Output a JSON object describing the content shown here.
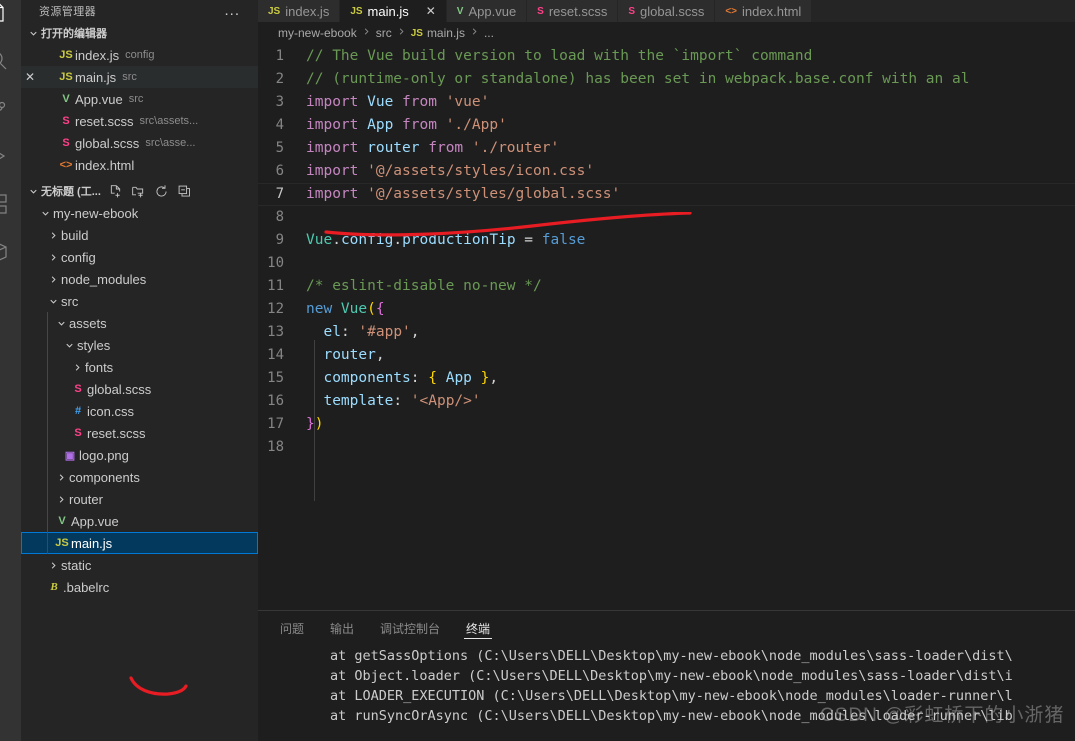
{
  "activitybar": {
    "items": [
      {
        "name": "explorer-icon",
        "active": true
      },
      {
        "name": "search-icon",
        "active": false
      },
      {
        "name": "source-control-icon",
        "active": false
      },
      {
        "name": "run-and-debug-icon",
        "active": false
      },
      {
        "name": "extensions-icon",
        "active": false
      },
      {
        "name": "remote-explorer-icon",
        "active": false
      }
    ]
  },
  "sidebar": {
    "title": "资源管理器",
    "more_label": "...",
    "open_editors": {
      "label": "打开的编辑器",
      "items": [
        {
          "name": "index.js",
          "desc": "config",
          "icon": "js",
          "active": false,
          "dirty": false
        },
        {
          "name": "main.js",
          "desc": "src",
          "icon": "js",
          "active": true,
          "dirty": false
        },
        {
          "name": "App.vue",
          "desc": "src",
          "icon": "vue",
          "active": false,
          "dirty": false
        },
        {
          "name": "reset.scss",
          "desc": "src\\assets...",
          "icon": "scss",
          "active": false,
          "dirty": false
        },
        {
          "name": "global.scss",
          "desc": "src\\asse...",
          "icon": "scss",
          "active": false,
          "dirty": false
        },
        {
          "name": "index.html",
          "desc": "",
          "icon": "html",
          "active": false,
          "dirty": false
        }
      ],
      "close_glyph": "✕"
    },
    "workspace": {
      "label": "无标题 (工...",
      "actions": [
        "new-file-icon",
        "new-folder-icon",
        "refresh-icon",
        "collapse-all-icon"
      ],
      "tree": [
        {
          "label": "my-new-ebook",
          "depth": 1,
          "type": "folder",
          "expanded": true
        },
        {
          "label": "build",
          "depth": 2,
          "type": "folder",
          "expanded": false
        },
        {
          "label": "config",
          "depth": 2,
          "type": "folder",
          "expanded": false
        },
        {
          "label": "node_modules",
          "depth": 2,
          "type": "folder",
          "expanded": false
        },
        {
          "label": "src",
          "depth": 2,
          "type": "folder",
          "expanded": true
        },
        {
          "label": "assets",
          "depth": 3,
          "type": "folder",
          "expanded": true
        },
        {
          "label": "styles",
          "depth": 4,
          "type": "folder",
          "expanded": true
        },
        {
          "label": "fonts",
          "depth": 5,
          "type": "folder",
          "expanded": false
        },
        {
          "label": "global.scss",
          "depth": 5,
          "type": "file",
          "icon": "scss"
        },
        {
          "label": "icon.css",
          "depth": 5,
          "type": "file",
          "icon": "css"
        },
        {
          "label": "reset.scss",
          "depth": 5,
          "type": "file",
          "icon": "scss"
        },
        {
          "label": "logo.png",
          "depth": 4,
          "type": "file",
          "icon": "png"
        },
        {
          "label": "components",
          "depth": 3,
          "type": "folder",
          "expanded": false
        },
        {
          "label": "router",
          "depth": 3,
          "type": "folder",
          "expanded": false
        },
        {
          "label": "App.vue",
          "depth": 3,
          "type": "file",
          "icon": "vue"
        },
        {
          "label": "main.js",
          "depth": 3,
          "type": "file",
          "icon": "js",
          "selected": true
        },
        {
          "label": "static",
          "depth": 2,
          "type": "folder",
          "expanded": false
        },
        {
          "label": ".babelrc",
          "depth": 2,
          "type": "file",
          "icon": "babel"
        }
      ]
    }
  },
  "tabs": [
    {
      "label": "index.js",
      "icon": "js",
      "active": false
    },
    {
      "label": "main.js",
      "icon": "js",
      "active": true,
      "close": "✕"
    },
    {
      "label": "App.vue",
      "icon": "vue",
      "active": false
    },
    {
      "label": "reset.scss",
      "icon": "scss",
      "active": false
    },
    {
      "label": "global.scss",
      "icon": "scss",
      "active": false
    },
    {
      "label": "index.html",
      "icon": "html",
      "active": false
    }
  ],
  "breadcrumbs": [
    "my-new-ebook",
    "src",
    "main.js",
    "..."
  ],
  "editor": {
    "current_line": 7,
    "lines": [
      {
        "n": 1,
        "tokens": [
          {
            "t": "com",
            "v": "// The Vue build version to load with the `import` command"
          }
        ]
      },
      {
        "n": 2,
        "tokens": [
          {
            "t": "com",
            "v": "// (runtime-only or standalone) has been set in webpack.base.conf with an al"
          }
        ]
      },
      {
        "n": 3,
        "tokens": [
          {
            "t": "kw",
            "v": "import "
          },
          {
            "t": "var",
            "v": "Vue"
          },
          {
            "t": "kw",
            "v": " from "
          },
          {
            "t": "str",
            "v": "'vue'"
          }
        ]
      },
      {
        "n": 4,
        "tokens": [
          {
            "t": "kw",
            "v": "import "
          },
          {
            "t": "var",
            "v": "App"
          },
          {
            "t": "kw",
            "v": " from "
          },
          {
            "t": "str",
            "v": "'./App'"
          }
        ]
      },
      {
        "n": 5,
        "tokens": [
          {
            "t": "kw",
            "v": "import "
          },
          {
            "t": "var",
            "v": "router"
          },
          {
            "t": "kw",
            "v": " from "
          },
          {
            "t": "str",
            "v": "'./router'"
          }
        ]
      },
      {
        "n": 6,
        "tokens": [
          {
            "t": "kw",
            "v": "import "
          },
          {
            "t": "str",
            "v": "'@/assets/styles/icon.css'"
          }
        ]
      },
      {
        "n": 7,
        "tokens": [
          {
            "t": "kw",
            "v": "import "
          },
          {
            "t": "str",
            "v": "'@/assets/styles/global.scss'"
          }
        ]
      },
      {
        "n": 8,
        "tokens": []
      },
      {
        "n": 9,
        "tokens": [
          {
            "t": "cls",
            "v": "Vue"
          },
          {
            "t": "pl",
            "v": "."
          },
          {
            "t": "var",
            "v": "config"
          },
          {
            "t": "pl",
            "v": "."
          },
          {
            "t": "var",
            "v": "productionTip"
          },
          {
            "t": "pl",
            "v": " = "
          },
          {
            "t": "blue",
            "v": "false"
          }
        ]
      },
      {
        "n": 10,
        "tokens": []
      },
      {
        "n": 11,
        "tokens": [
          {
            "t": "com",
            "v": "/* eslint-disable no-new */"
          }
        ]
      },
      {
        "n": 12,
        "tokens": [
          {
            "t": "blue",
            "v": "new "
          },
          {
            "t": "cls",
            "v": "Vue"
          },
          {
            "t": "br1",
            "v": "("
          },
          {
            "t": "br2",
            "v": "{"
          }
        ]
      },
      {
        "n": 13,
        "tokens": [
          {
            "t": "pl",
            "v": "  "
          },
          {
            "t": "prop",
            "v": "el"
          },
          {
            "t": "pl",
            "v": ": "
          },
          {
            "t": "str",
            "v": "'#app'"
          },
          {
            "t": "pl",
            "v": ","
          }
        ]
      },
      {
        "n": 14,
        "tokens": [
          {
            "t": "pl",
            "v": "  "
          },
          {
            "t": "prop",
            "v": "router"
          },
          {
            "t": "pl",
            "v": ","
          }
        ]
      },
      {
        "n": 15,
        "tokens": [
          {
            "t": "pl",
            "v": "  "
          },
          {
            "t": "prop",
            "v": "components"
          },
          {
            "t": "pl",
            "v": ": "
          },
          {
            "t": "br1",
            "v": "{"
          },
          {
            "t": "var",
            "v": " App "
          },
          {
            "t": "br1",
            "v": "}"
          },
          {
            "t": "pl",
            "v": ","
          }
        ]
      },
      {
        "n": 16,
        "tokens": [
          {
            "t": "pl",
            "v": "  "
          },
          {
            "t": "prop",
            "v": "template"
          },
          {
            "t": "pl",
            "v": ": "
          },
          {
            "t": "str",
            "v": "'<App/>'"
          }
        ]
      },
      {
        "n": 17,
        "tokens": [
          {
            "t": "br2",
            "v": "}"
          },
          {
            "t": "br1",
            "v": ")"
          }
        ]
      },
      {
        "n": 18,
        "tokens": []
      }
    ]
  },
  "panel": {
    "tabs": [
      {
        "label": "问题",
        "active": false
      },
      {
        "label": "输出",
        "active": false
      },
      {
        "label": "调试控制台",
        "active": false
      },
      {
        "label": "终端",
        "active": true
      }
    ],
    "terminal_lines": [
      "at getSassOptions (C:\\Users\\DELL\\Desktop\\my-new-ebook\\node_modules\\sass-loader\\dist\\",
      "at Object.loader (C:\\Users\\DELL\\Desktop\\my-new-ebook\\node_modules\\sass-loader\\dist\\i",
      "at LOADER_EXECUTION (C:\\Users\\DELL\\Desktop\\my-new-ebook\\node_modules\\loader-runner\\l",
      "at runSyncOrAsync (C:\\Users\\DELL\\Desktop\\my-new-ebook\\node_modules\\loader-runner\\lib"
    ]
  },
  "watermark": "CSDN @彩虹桥下的小浙猪",
  "colors": {
    "accent": "#0078d4",
    "selection_bg": "#04395e",
    "editor_bg": "#1e1e1e",
    "sidebar_bg": "#252526",
    "activitybar_bg": "#333333",
    "annotation_red": "#e81c23"
  }
}
